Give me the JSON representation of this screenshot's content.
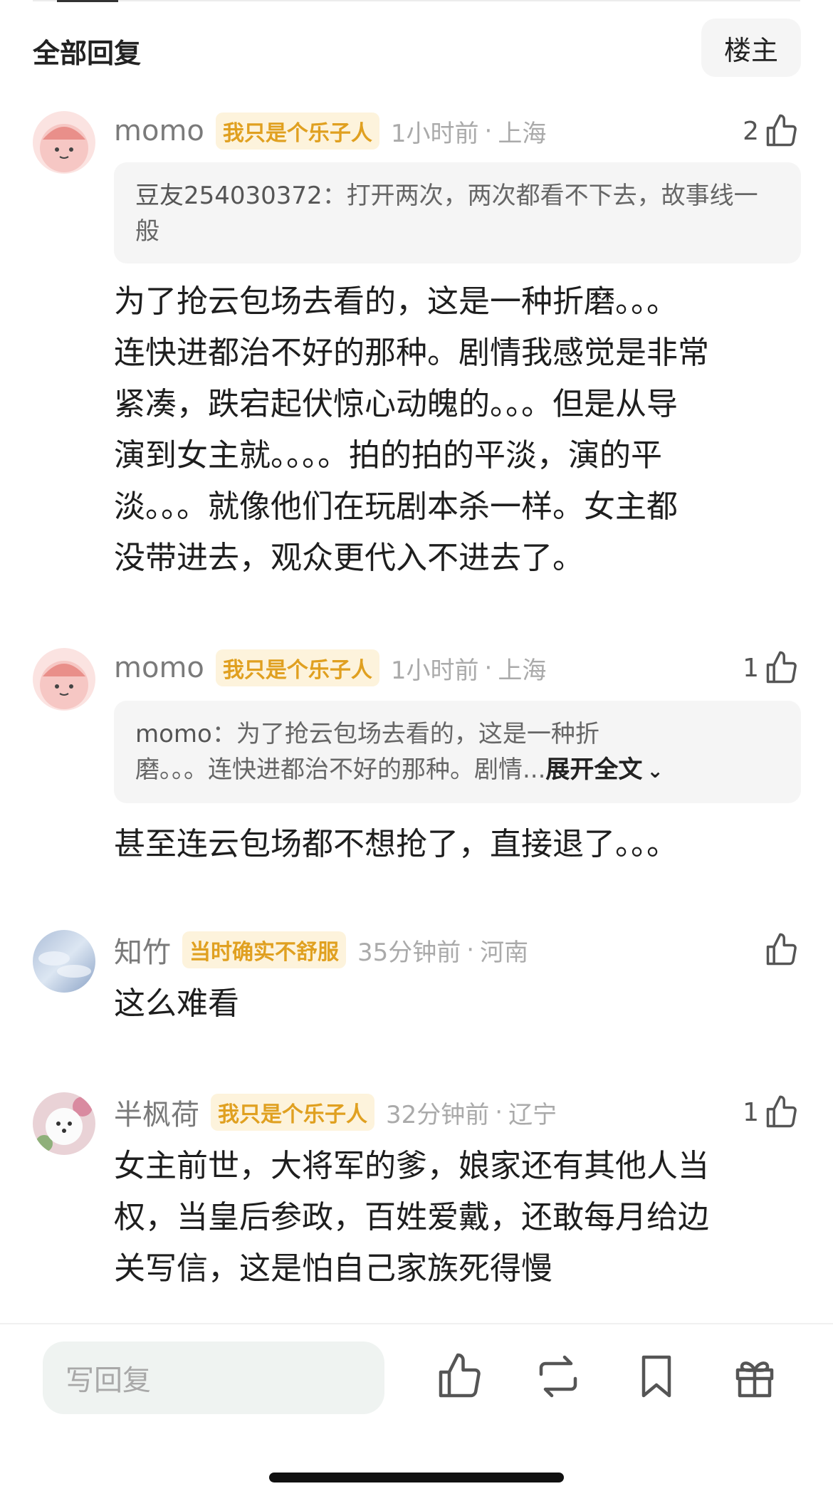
{
  "header": {
    "title": "全部回复",
    "op_button_label": "楼主"
  },
  "comments": [
    {
      "avatar": "peach-cartoon-avatar",
      "username": "momo",
      "tag": "我只是个乐子人",
      "time": "1小时前",
      "separator": "·",
      "location": "上海",
      "likes": "2",
      "quote": {
        "author": "豆友254030372",
        "colon": "：",
        "text": "打开两次，两次都看不下去，故事线一般"
      },
      "body_lines": [
        "为了抢云包场去看的，这是一种折磨。。。",
        "连快进都治不好的那种。剧情我感觉是非常",
        "紧凑，跌宕起伏惊心动魄的。。。但是从导",
        "演到女主就。。。。拍的拍的平淡，演的平",
        "淡。。。就像他们在玩剧本杀一样。女主都",
        "没带进去，观众更代入不进去了。"
      ]
    },
    {
      "avatar": "peach-cartoon-avatar",
      "username": "momo",
      "tag": "我只是个乐子人",
      "time": "1小时前",
      "separator": "·",
      "location": "上海",
      "likes": "1",
      "quote": {
        "author": "momo",
        "colon": "：",
        "line1": "为了抢云包场去看的，这是一种折",
        "line2": "磨。。。连快进都治不好的那种。剧情...",
        "expand_label": "展开全文"
      },
      "body_lines": [
        "甚至连云包场都不想抢了，直接退了。。。"
      ]
    },
    {
      "avatar": "sky-cloud-avatar",
      "username": "知竹",
      "tag": "当时确实不舒服",
      "time": "35分钟前",
      "separator": "·",
      "location": "河南",
      "likes": "",
      "body_lines": [
        "这么难看"
      ]
    },
    {
      "avatar": "white-dog-avatar",
      "username": "半枫荷",
      "tag": "我只是个乐子人",
      "time": "32分钟前",
      "separator": "·",
      "location": "辽宁",
      "likes": "1",
      "body_lines": [
        "女主前世，大将军的爹，娘家还有其他人当",
        "权，当皇后参政，百姓爱戴，还敢每月给边",
        "关写信，这是怕自己家族死得慢"
      ]
    }
  ],
  "bottom_bar": {
    "reply_placeholder": "写回复",
    "icons": [
      "thumbs-up-icon",
      "repost-icon",
      "bookmark-icon",
      "gift-icon"
    ]
  },
  "colors": {
    "tag_text": "#e0a020",
    "tag_bg": "#fdf3dc",
    "meta_gray": "#aaaaaa",
    "input_bg": "#eff3f1"
  }
}
